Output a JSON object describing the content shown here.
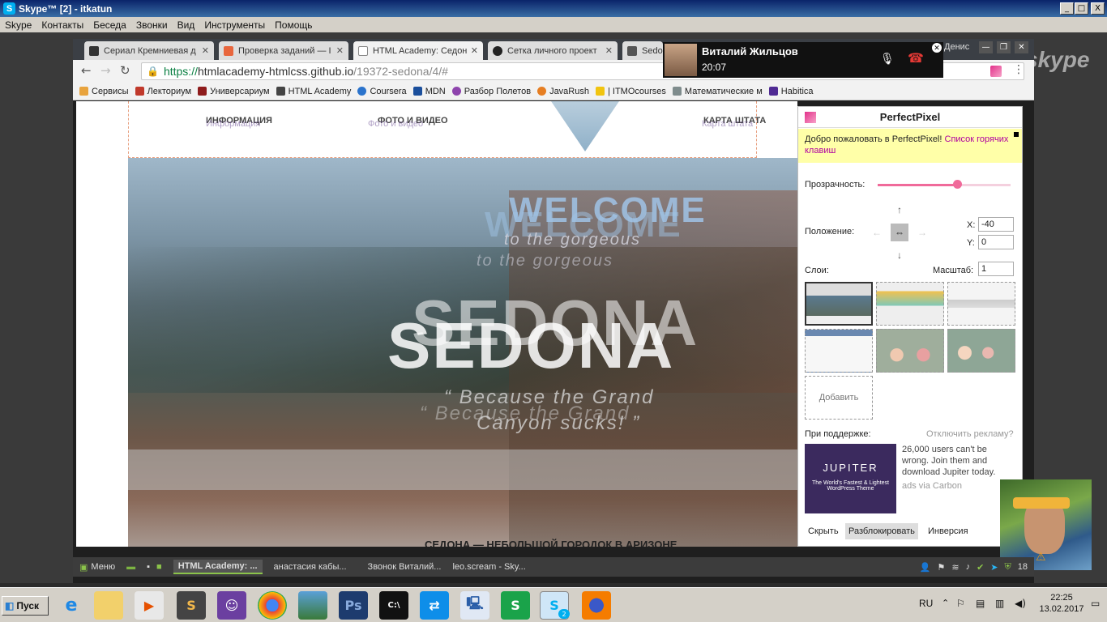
{
  "window": {
    "title": "Skype™ [2] - itkatun",
    "buttons": [
      "_",
      "□",
      "X"
    ]
  },
  "menubar": [
    "Skype",
    "Контакты",
    "Беседа",
    "Звонки",
    "Вид",
    "Инструменты",
    "Помощь"
  ],
  "skype_watermark": "skype",
  "call": {
    "name": "Виталий Жильцов",
    "time": "20:07",
    "other_user": "Денис"
  },
  "browser": {
    "tabs": [
      {
        "label": "Сериал Кремниевая д",
        "color": "#333333"
      },
      {
        "label": "Проверка заданий — I",
        "color": "#e8663d"
      },
      {
        "label": "HTML Academy: Седон",
        "color": "#555555"
      },
      {
        "label": "Сетка личного проект",
        "color": "#222222"
      },
      {
        "label": "Sedo",
        "color": "#555555"
      }
    ],
    "url_scheme": "https://",
    "url_host": "htmlacademy-htmlcss.github.io",
    "url_path": "/19372-sedona/4/#",
    "bookmarks": [
      {
        "label": "Сервисы",
        "color": "#e8a33d"
      },
      {
        "label": "Лекториум",
        "color": "#c0392b"
      },
      {
        "label": "Универсариум",
        "color": "#8e1b1b"
      },
      {
        "label": "HTML Academy",
        "color": "#444444"
      },
      {
        "label": "Coursera",
        "color": "#2a73cc"
      },
      {
        "label": "MDN",
        "color": "#1b4f9c"
      },
      {
        "label": "Разбор Полетов",
        "color": "#8e44ad"
      },
      {
        "label": "JavaRush",
        "color": "#e67e22"
      },
      {
        "label": "| ITMOcourses",
        "color": "#f1c40f"
      },
      {
        "label": "Математические м",
        "color": "#7f8c8d"
      },
      {
        "label": "Habitica",
        "color": "#4f2a93"
      }
    ]
  },
  "sedona": {
    "nav": [
      "ИНФОРМАЦИЯ",
      "ФОТО И ВИДЕО",
      "КАРТА ШТАТА"
    ],
    "nav_ghost": [
      "Информация",
      "Фото и видео",
      "Карта штата"
    ],
    "welcome": "WELCOME",
    "to_the_gorgeous": "to the gorgeous",
    "sedona_word": "SEDONA",
    "quote_line1": "“ Because the Grand",
    "quote_line2": "Canyon sucks! ”",
    "footer_title": "СЕДОНА — НЕБОЛЬШОЙ ГОРОДОК В АРИЗОНЕ"
  },
  "perfectpixel": {
    "title": "PerfectPixel",
    "welcome_text": "Добро пожаловать в PerfectPixel!",
    "welcome_link": "Список горячих клавиш",
    "opacity_label": "Прозрачность:",
    "opacity_value": 0.6,
    "position_label": "Положение:",
    "x_label": "X:",
    "x_value": "-40",
    "y_label": "Y:",
    "y_value": "0",
    "layers_label": "Слои:",
    "scale_label": "Масштаб:",
    "scale_value": "1",
    "add_label": "Добавить",
    "support_label": "При поддержке:",
    "disable_ads": "Отключить рекламу?",
    "ad_brand": "JUPITER",
    "ad_tagline": "The World's Fastest & Lightest WordPress Theme",
    "ad_text": "26,000 users can't be wrong. Join them and download Jupiter today.",
    "ad_source": "ads via Carbon",
    "btn_hide": "Скрыть",
    "btn_unlock": "Разблокировать",
    "btn_invert": "Инверсия"
  },
  "linux_panel": {
    "menu": "Меню",
    "tasks": [
      "HTML Academy: ...",
      "анастасия кабы...",
      "Звонок Виталий...",
      "leo.scream - Sky..."
    ],
    "tray_number": "18"
  },
  "taskbar": {
    "start": "Пуск",
    "lang": "RU",
    "time": "22:25",
    "date": "13.02.2017",
    "skype_badge": "2"
  }
}
